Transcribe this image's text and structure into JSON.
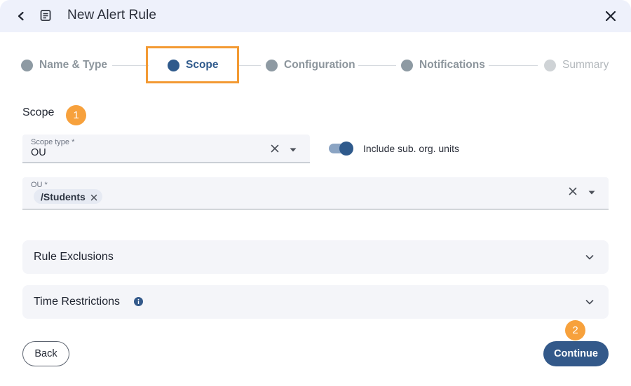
{
  "header": {
    "title": "New Alert Rule",
    "back_icon": "chevron-left-icon",
    "doc_icon": "document-icon",
    "close_icon": "close-icon"
  },
  "stepper": {
    "steps": [
      {
        "label": "Name & Type",
        "state": "completed"
      },
      {
        "label": "Scope",
        "state": "active"
      },
      {
        "label": "Configuration",
        "state": "upcoming"
      },
      {
        "label": "Notifications",
        "state": "upcoming"
      },
      {
        "label": "Summary",
        "state": "disabled"
      }
    ]
  },
  "scope": {
    "section_title": "Scope",
    "badge_1": "1",
    "scope_type": {
      "label": "Scope type *",
      "value": "OU"
    },
    "include_sub_units": {
      "label": "Include sub. org. units",
      "checked": true
    },
    "ou": {
      "label": "OU *",
      "chips": [
        "/Students"
      ]
    }
  },
  "accordions": {
    "rule_exclusions": "Rule Exclusions",
    "time_restrictions": "Time Restrictions"
  },
  "footer": {
    "back_label": "Back",
    "continue_label": "Continue",
    "badge_2": "2"
  },
  "colors": {
    "primary": "#33598a",
    "highlight": "#f39a33",
    "badge": "#f7a13c",
    "titlebar": "#eef1fb"
  }
}
